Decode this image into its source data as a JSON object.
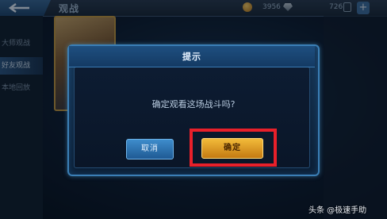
{
  "topbar": {
    "title": "观战",
    "coins": "3956",
    "vouchers": "726",
    "add_label": "+"
  },
  "sidebar": {
    "items": [
      {
        "label": "大师观战"
      },
      {
        "label": "好友观战"
      },
      {
        "label": "本地回放"
      }
    ]
  },
  "dialog": {
    "title": "提示",
    "message": "确定观看这场战斗吗?",
    "cancel_label": "取消",
    "confirm_label": "确定"
  },
  "annotation": {
    "highlight_color": "#e8202a"
  },
  "watermark": {
    "text": "头条 @极速手助"
  },
  "colors": {
    "accent_blue": "#3b7fb6",
    "confirm_gold": "#f2bb3a"
  }
}
